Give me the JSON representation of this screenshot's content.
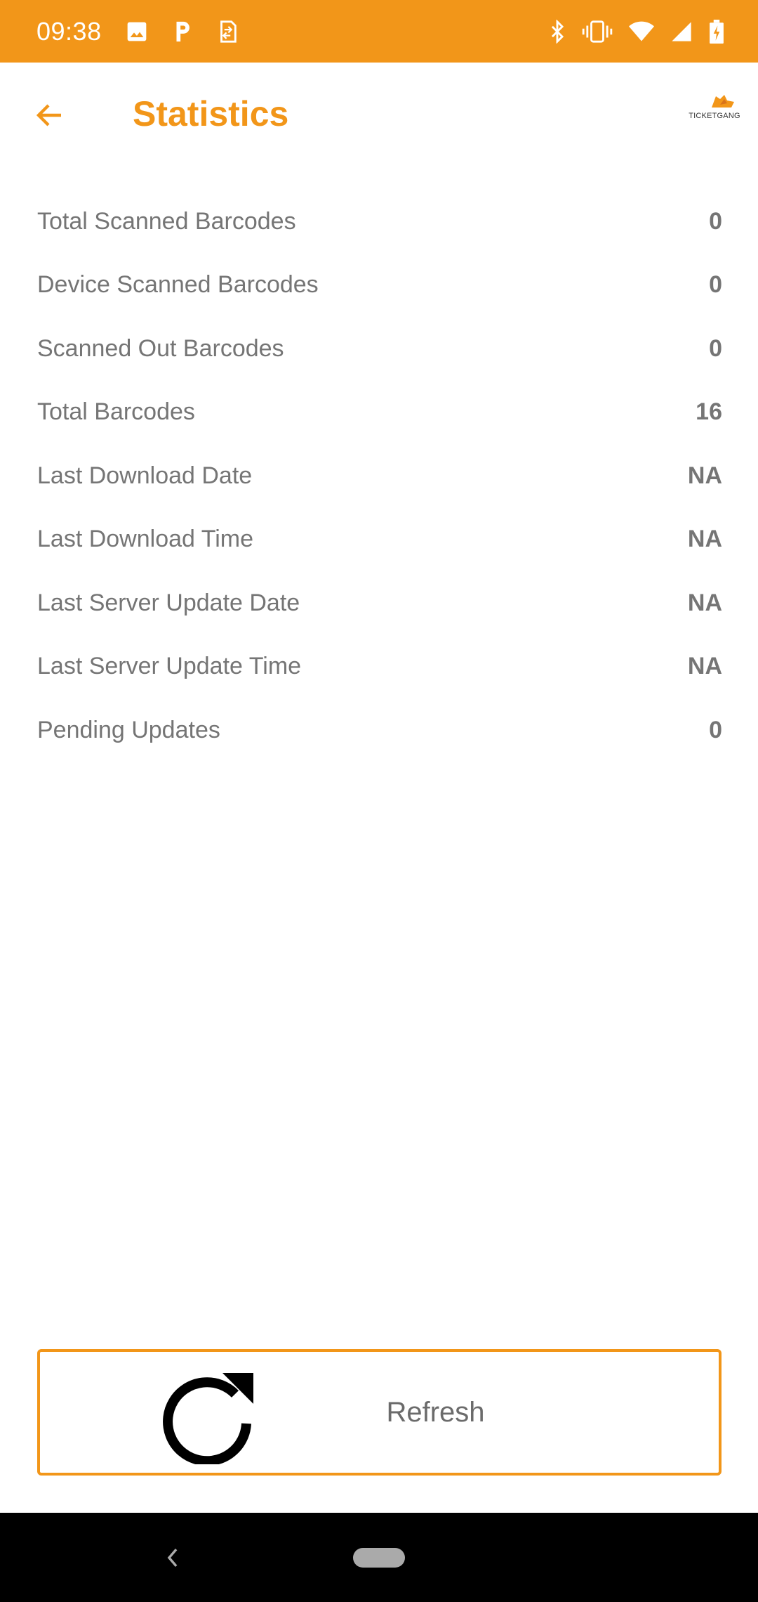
{
  "status_bar": {
    "time": "09:38",
    "left_icons": [
      "image-icon",
      "parking-icon",
      "sim-transfer-icon"
    ],
    "right_icons": [
      "bluetooth-icon",
      "vibrate-icon",
      "wifi-icon",
      "signal-icon",
      "battery-charging-icon"
    ]
  },
  "header": {
    "title": "Statistics",
    "back_icon": "arrow-left-icon",
    "logo_text": "TICKETGANG"
  },
  "stats": [
    {
      "label": "Total Scanned Barcodes",
      "value": "0"
    },
    {
      "label": "Device Scanned Barcodes",
      "value": "0"
    },
    {
      "label": "Scanned Out Barcodes",
      "value": "0"
    },
    {
      "label": "Total Barcodes",
      "value": "16"
    },
    {
      "label": "Last Download Date",
      "value": "NA"
    },
    {
      "label": "Last Download Time",
      "value": "NA"
    },
    {
      "label": "Last Server Update Date",
      "value": "NA"
    },
    {
      "label": "Last Server Update Time",
      "value": "NA"
    },
    {
      "label": "Pending Updates",
      "value": "0"
    }
  ],
  "refresh": {
    "label": "Refresh",
    "icon": "refresh-icon"
  },
  "colors": {
    "accent": "#F29619",
    "text_gray": "#757575",
    "nav_bar": "#000000"
  }
}
